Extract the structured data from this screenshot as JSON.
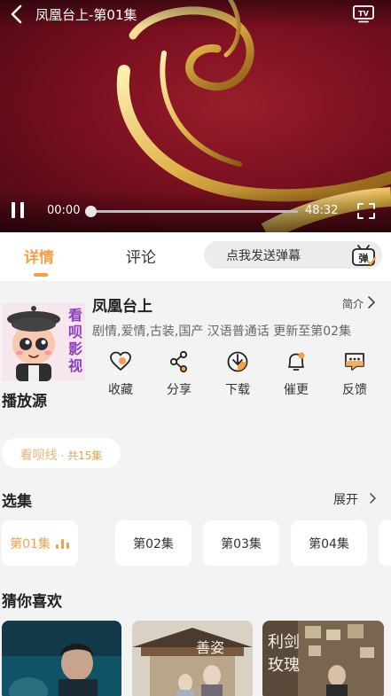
{
  "player": {
    "title": "凤凰台上-第01集",
    "time_current": "00:00",
    "time_total": "48:32",
    "progress_fraction": 0.0
  },
  "tabs": [
    {
      "label": "详情",
      "active": true
    },
    {
      "label": "评论",
      "active": false
    }
  ],
  "danmaku": {
    "placeholder": "点我发送弹幕",
    "icon_label": "弹"
  },
  "show": {
    "poster_text": "看呗影视",
    "title": "凤凰台上",
    "intro_label": "简介",
    "tags": "剧情,爱情,古装,国产 汉语普通话 更新至第02集"
  },
  "actions": [
    {
      "label": "收藏",
      "icon": "heart-icon"
    },
    {
      "label": "分享",
      "icon": "share-icon"
    },
    {
      "label": "下载",
      "icon": "download-icon"
    },
    {
      "label": "催更",
      "icon": "bell-icon"
    },
    {
      "label": "反馈",
      "icon": "feedback-icon"
    }
  ],
  "source": {
    "section_title": "播放源",
    "name": "看呗线",
    "count": " · 共15集"
  },
  "episodes": {
    "section_title": "选集",
    "expand_label": "展开",
    "items": [
      {
        "label": "第01集",
        "active": true
      },
      {
        "label": "第02集",
        "active": false
      },
      {
        "label": "第03集",
        "active": false
      },
      {
        "label": "第04集",
        "active": false
      }
    ]
  },
  "recommend": {
    "section_title": "猜你喜欢"
  },
  "colors": {
    "accent": "#f2a14a",
    "player_bg": "#7a1020",
    "gold": "#e0b24a"
  }
}
